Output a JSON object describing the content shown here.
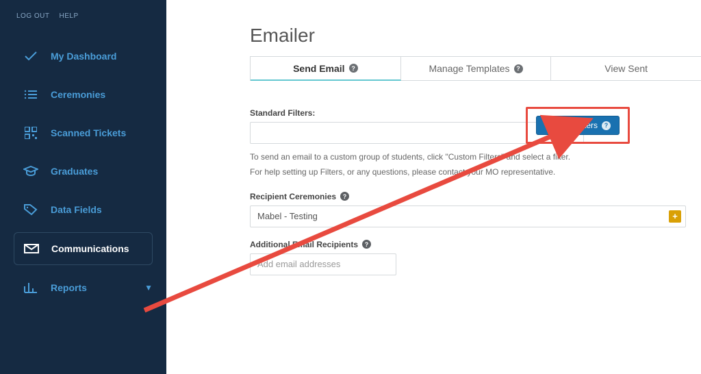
{
  "top_links": {
    "logout": "LOG OUT",
    "help": "HELP"
  },
  "sidebar": {
    "items": [
      {
        "label": "My Dashboard"
      },
      {
        "label": "Ceremonies"
      },
      {
        "label": "Scanned Tickets"
      },
      {
        "label": "Graduates"
      },
      {
        "label": "Data Fields"
      },
      {
        "label": "Communications"
      },
      {
        "label": "Reports"
      }
    ]
  },
  "page": {
    "title": "Emailer"
  },
  "tabs": {
    "send_email": "Send Email",
    "manage_templates": "Manage Templates",
    "view_sent": "View Sent"
  },
  "filters": {
    "standard_label": "Standard Filters:",
    "custom_button": "Custom Filters",
    "hint1": "To send an email to a custom group of students, click \"Custom Filters\" and select a filter.",
    "hint2": "For help setting up Filters, or any questions, please contact your MO representative."
  },
  "recipients": {
    "label": "Recipient Ceremonies",
    "value": "Mabel - Testing"
  },
  "additional": {
    "label": "Additional Email Recipients",
    "placeholder": "Add email addresses"
  }
}
